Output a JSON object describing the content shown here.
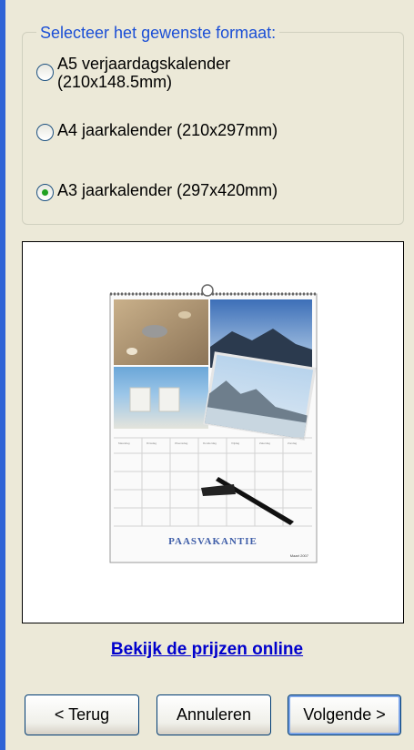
{
  "format_group": {
    "legend": "Selecteer het gewenste formaat:",
    "options": [
      {
        "label_line1": "A5 verjaardagskalender",
        "label_line2": "(210x148.5mm)",
        "selected": false
      },
      {
        "label_line1": "A4 jaarkalender (210x297mm)",
        "label_line2": "",
        "selected": false
      },
      {
        "label_line1": "A3 jaarkalender (297x420mm)",
        "label_line2": "",
        "selected": true
      }
    ]
  },
  "preview": {
    "caption": "PAASVAKANTIE",
    "month": "Maart 2007",
    "weekdays": [
      "Maandag",
      "Dinsdag",
      "Woensdag",
      "Donderdag",
      "Vrijdag",
      "Zaterdag",
      "Zondag"
    ]
  },
  "prices_link": "Bekijk de prijzen online",
  "buttons": {
    "back": "< Terug",
    "cancel": "Annuleren",
    "next": "Volgende >"
  }
}
